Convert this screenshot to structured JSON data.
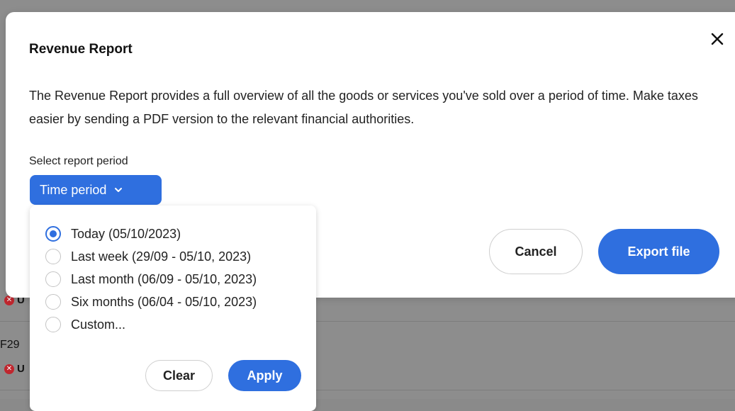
{
  "background": {
    "row_code": "F29",
    "status_1": "U",
    "status_2": "U"
  },
  "modal": {
    "title": "Revenue Report",
    "description": "The Revenue Report provides a full overview of all the goods or services you've sold over a period of time. Make taxes easier by sending a PDF version to the relevant financial authorities.",
    "period_label": "Select report period",
    "period_button_label": "Time period",
    "cancel_label": "Cancel",
    "export_label": "Export file"
  },
  "dropdown": {
    "options": [
      {
        "label": "Today (05/10/2023)",
        "checked": true
      },
      {
        "label": "Last week (29/09 - 05/10, 2023)",
        "checked": false
      },
      {
        "label": "Last month (06/09 - 05/10, 2023)",
        "checked": false
      },
      {
        "label": "Six months (06/04 - 05/10, 2023)",
        "checked": false
      },
      {
        "label": "Custom...",
        "checked": false
      }
    ],
    "clear_label": "Clear",
    "apply_label": "Apply"
  },
  "colors": {
    "accent": "#2f6fdf",
    "overlay": "#8d8d8d",
    "error": "#c0262e"
  },
  "icons": {
    "close": "close-icon",
    "chevron": "chevron-down-icon",
    "status_error": "error-x-icon"
  }
}
